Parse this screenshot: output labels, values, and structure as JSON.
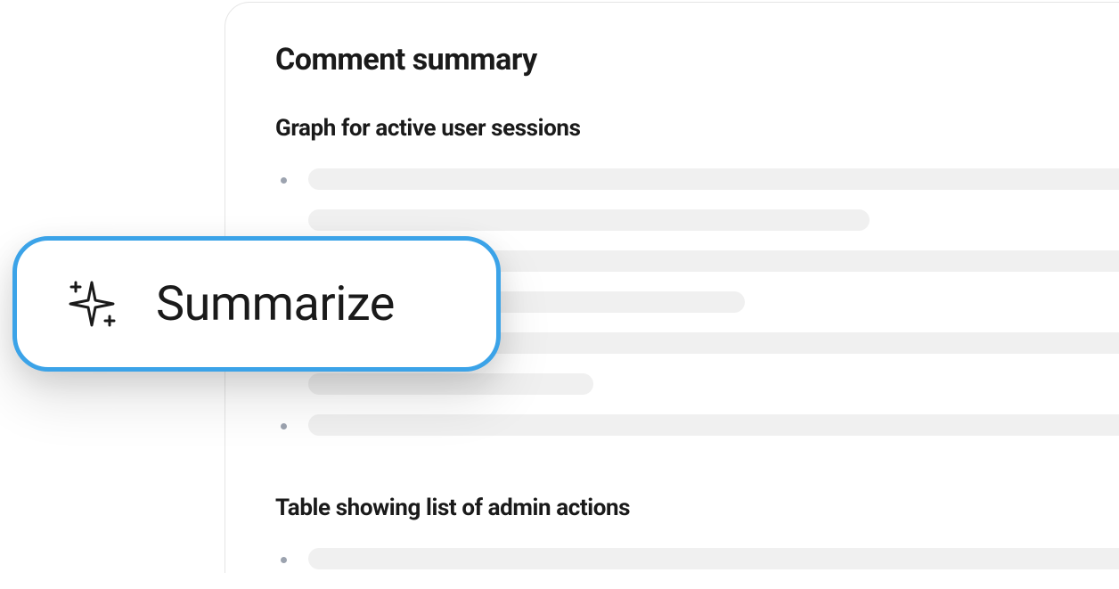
{
  "panel": {
    "title": "Comment summary",
    "sections": [
      {
        "heading": "Graph for active user sessions"
      },
      {
        "heading": "Table showing list of admin actions"
      }
    ]
  },
  "action": {
    "summarize_label": "Summarize"
  }
}
